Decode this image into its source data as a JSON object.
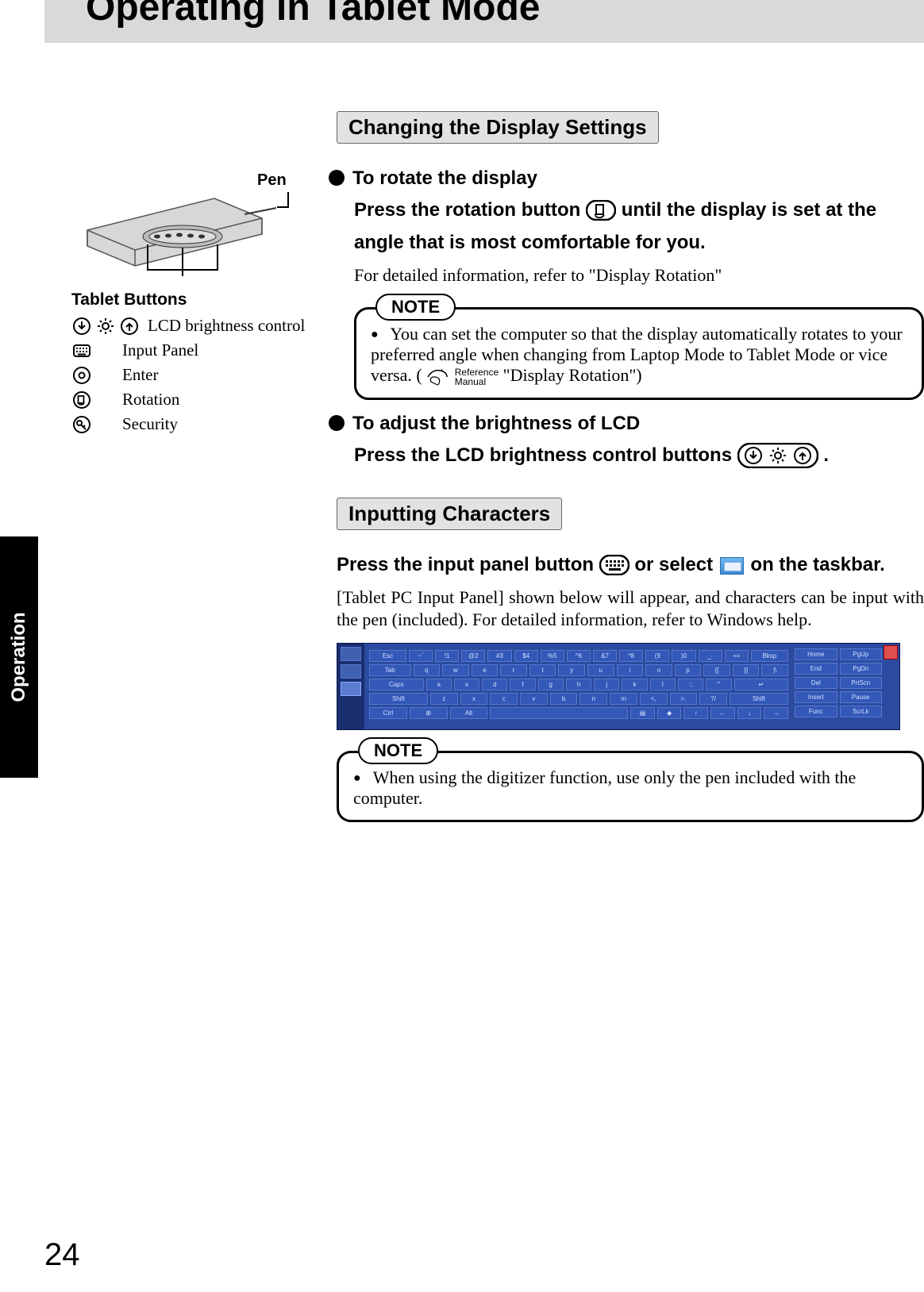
{
  "page": {
    "number": "24",
    "title": "Operating in Tablet Mode",
    "side_tab": "Operation"
  },
  "sidebar": {
    "pen_label": "Pen",
    "tablet_buttons_title": "Tablet Buttons",
    "items": [
      {
        "label": "LCD brightness control"
      },
      {
        "label": "Input Panel"
      },
      {
        "label": "Enter"
      },
      {
        "label": "Rotation"
      },
      {
        "label": "Security"
      }
    ]
  },
  "sections": {
    "changing": {
      "heading": "Changing the Display Settings",
      "rotate": {
        "title": "To rotate the display",
        "cmd_before": "Press the rotation button ",
        "cmd_after": " until the display is set at the angle that is most comfortable for you.",
        "detail": "For detailed information, refer to \"Display Rotation\""
      },
      "note1": {
        "label": "NOTE",
        "text_before": "You can set the computer so that the display automatically rotates to your preferred angle when changing from Laptop Mode to Tablet Mode or vice versa.  ( ",
        "ref": "Reference Manual",
        "text_after": " \"Display Rotation\")"
      },
      "brightness": {
        "title": "To adjust the brightness of LCD",
        "cmd_before": "Press the LCD brightness control buttons ",
        "cmd_after": " ."
      }
    },
    "inputting": {
      "heading": "Inputting Characters",
      "cmd_a": "Press the input panel button ",
      "cmd_b": " or select ",
      "cmd_c": " on the taskbar.",
      "body": "[Tablet PC Input Panel] shown below will appear, and characters can be input with the pen (included).  For detailed information, refer to Windows help.",
      "note2": {
        "label": "NOTE",
        "text": "When using the digitizer function, use only the pen included with the computer."
      }
    }
  },
  "keyboard": {
    "row1": [
      "Esc",
      "~`",
      "!1",
      "@2",
      "#3",
      "$4",
      "%5",
      "^6",
      "&7",
      "*8",
      "(9",
      ")0",
      "_-",
      "+=",
      "Bksp"
    ],
    "row2": [
      "Tab",
      "q",
      "w",
      "e",
      "r",
      "t",
      "y",
      "u",
      "i",
      "o",
      "p",
      "{[",
      "}]",
      "|\\"
    ],
    "row3": [
      "Caps",
      "a",
      "s",
      "d",
      "f",
      "g",
      "h",
      "j",
      "k",
      "l",
      ":;",
      "\"'",
      "↵"
    ],
    "row4": [
      "Shift",
      "z",
      "x",
      "c",
      "v",
      "b",
      "n",
      "m",
      "<,",
      ">.",
      "?/",
      "Shift"
    ],
    "row5": [
      "Ctrl",
      "⊞",
      "Alt",
      " ",
      "▤",
      "◆",
      "↑",
      "←",
      "↓",
      "→"
    ],
    "side": [
      [
        "Home",
        "PgUp"
      ],
      [
        "End",
        "PgDn"
      ],
      [
        "Del",
        "PrtScn"
      ],
      [
        "Insert",
        "Pause"
      ],
      [
        "Func",
        "ScrLk"
      ]
    ]
  }
}
